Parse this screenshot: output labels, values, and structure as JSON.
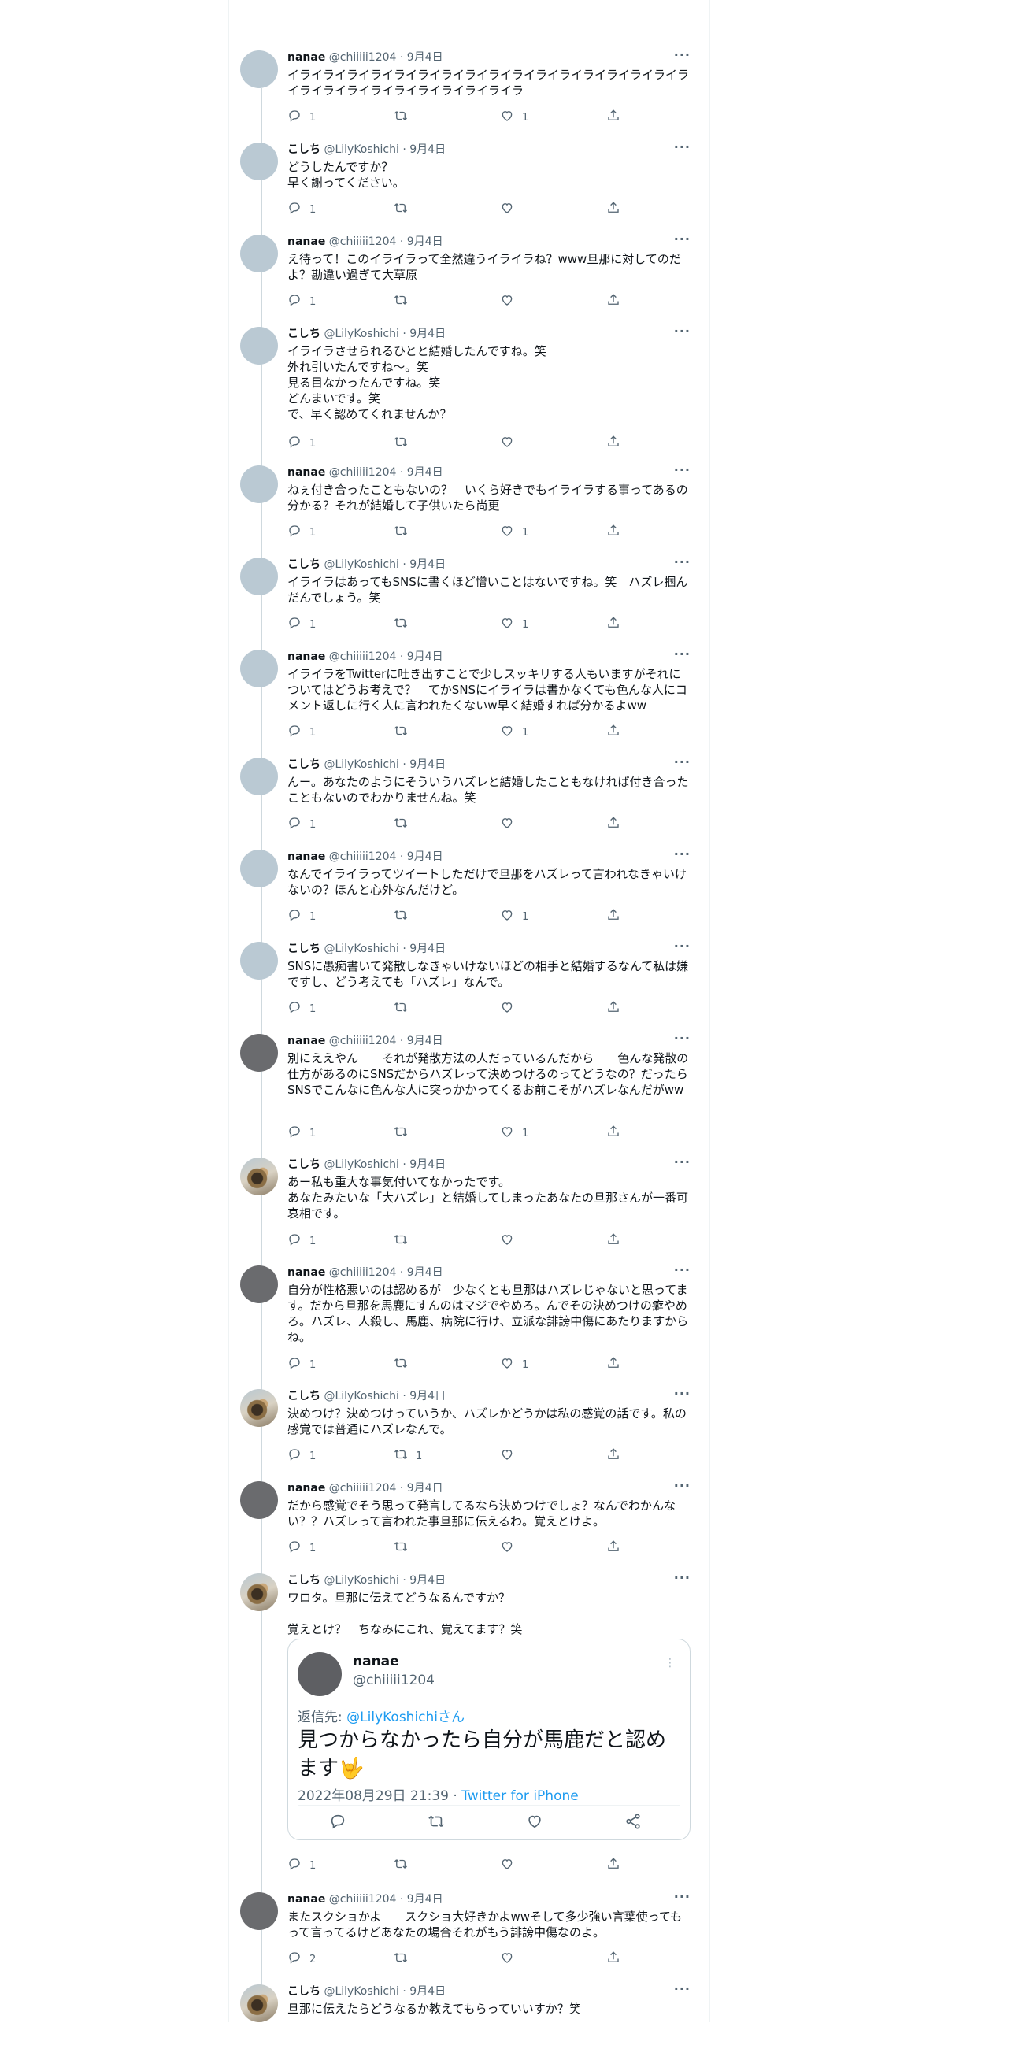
{
  "colors": {
    "accent": "#1d9bf0",
    "muted": "#536471",
    "thread": "#cfd9de"
  },
  "tweets": [
    {
      "name": "nanae",
      "handle": "@chiiiii1204",
      "date": "9月4日",
      "avatar": "light",
      "text": "イライライライライライライライライライライライライライライライライライライライライライライライライライライラ",
      "reply": "1",
      "retweet": "",
      "like": "1"
    },
    {
      "name": "こしち",
      "handle": "@LilyKoshichi",
      "date": "9月4日",
      "avatar": "light",
      "text": "どうしたんですか？\n早く謝ってください。",
      "reply": "1",
      "retweet": "",
      "like": ""
    },
    {
      "name": "nanae",
      "handle": "@chiiiii1204",
      "date": "9月4日",
      "avatar": "light",
      "text": "え待って！このイライラって全然違うイライラね？www旦那に対してのだよ？勘違い過ぎて大草原",
      "reply": "1",
      "retweet": "",
      "like": ""
    },
    {
      "name": "こしち",
      "handle": "@LilyKoshichi",
      "date": "9月4日",
      "avatar": "light",
      "text": "イライラさせられるひとと結婚したんですね。笑\n外れ引いたんですね〜。笑\n見る目なかったんですね。笑\nどんまいです。笑\nで、早く認めてくれませんか？",
      "reply": "1",
      "retweet": "",
      "like": ""
    },
    {
      "name": "nanae",
      "handle": "@chiiiii1204",
      "date": "9月4日",
      "avatar": "light",
      "text": "ねぇ付き合ったこともないの？　いくら好きでもイライラする事ってあるの分かる？それが結婚して子供いたら尚更",
      "reply": "1",
      "retweet": "",
      "like": "1"
    },
    {
      "name": "こしち",
      "handle": "@LilyKoshichi",
      "date": "9月4日",
      "avatar": "light",
      "text": "イライラはあってもSNSに書くほど憎いことはないですね。笑　ハズレ掴んだんでしょう。笑",
      "reply": "1",
      "retweet": "",
      "like": "1"
    },
    {
      "name": "nanae",
      "handle": "@chiiiii1204",
      "date": "9月4日",
      "avatar": "light",
      "text": "イライラをTwitterに吐き出すことで少しスッキリする人もいますがそれについてはどうお考えで？　てかSNSにイライラは書かなくても色んな人にコメント返しに行く人に言われたくないw早く結婚すれば分かるよww",
      "reply": "1",
      "retweet": "",
      "like": "1"
    },
    {
      "name": "こしち",
      "handle": "@LilyKoshichi",
      "date": "9月4日",
      "avatar": "light",
      "text": "んー。あなたのようにそういうハズレと結婚したこともなければ付き合ったこともないのでわかりませんね。笑",
      "reply": "1",
      "retweet": "",
      "like": ""
    },
    {
      "name": "nanae",
      "handle": "@chiiiii1204",
      "date": "9月4日",
      "avatar": "light",
      "text": "なんでイライラってツイートしただけで旦那をハズレって言われなきゃいけないの？ほんと心外なんだけど。",
      "reply": "1",
      "retweet": "",
      "like": "1"
    },
    {
      "name": "こしち",
      "handle": "@LilyKoshichi",
      "date": "9月4日",
      "avatar": "light",
      "text": "SNSに愚痴書いて発散しなきゃいけないほどの相手と結婚するなんて私は嫌ですし、どう考えても「ハズレ」なんで。",
      "reply": "1",
      "retweet": "",
      "like": ""
    },
    {
      "name": "nanae",
      "handle": "@chiiiii1204",
      "date": "9月4日",
      "avatar": "dark",
      "text": "別にええやん　　それが発散方法の人だっているんだから　　色んな発散の仕方があるのにSNSだからハズレって決めつけるのってどうなの？だったらSNSでこんなに色んな人に突っかかってくるお前こそがハズレなんだがww",
      "reply": "1",
      "retweet": "",
      "like": "1"
    },
    {
      "name": "こしち",
      "handle": "@LilyKoshichi",
      "date": "9月4日",
      "avatar": "photo",
      "text": "あー私も重大な事気付いてなかったです。\nあなたみたいな「大ハズレ」と結婚してしまったあなたの旦那さんが一番可哀相です。",
      "reply": "1",
      "retweet": "",
      "like": ""
    },
    {
      "name": "nanae",
      "handle": "@chiiiii1204",
      "date": "9月4日",
      "avatar": "dark",
      "text": "自分が性格悪いのは認めるが　少なくとも旦那はハズレじゃないと思ってます。だから旦那を馬鹿にすんのはマジでやめろ。んでその決めつけの癖やめろ。ハズレ、人殺し、馬鹿、病院に行け、立派な誹謗中傷にあたりますからね。",
      "reply": "1",
      "retweet": "",
      "like": "1"
    },
    {
      "name": "こしち",
      "handle": "@LilyKoshichi",
      "date": "9月4日",
      "avatar": "photo",
      "text": "決めつけ？決めつけっていうか、ハズレかどうかは私の感覚の話です。私の感覚では普通にハズレなんで。",
      "reply": "1",
      "retweet": "1",
      "like": ""
    },
    {
      "name": "nanae",
      "handle": "@chiiiii1204",
      "date": "9月4日",
      "avatar": "dark",
      "text": "だから感覚でそう思って発言してるなら決めつけでしょ？なんでわかんない？？ハズレって言われた事旦那に伝えるわ。覚えとけよ。",
      "reply": "1",
      "retweet": "",
      "like": ""
    },
    {
      "name": "こしち",
      "handle": "@LilyKoshichi",
      "date": "9月4日",
      "avatar": "photo",
      "text": "ワロタ。旦那に伝えてどうなるんですか？\n\n覚えとけ？　ちなみにこれ、覚えてます？笑",
      "reply": "1",
      "retweet": "",
      "like": ""
    },
    {
      "name": "nanae",
      "handle": "@chiiiii1204",
      "date": "9月4日",
      "avatar": "dark",
      "text": "またスクショかよ　　スクショ大好きかよwwそして多少強い言葉使ってもって言ってるけどあなたの場合それがもう誹謗中傷なのよ。",
      "reply": "2",
      "retweet": "",
      "like": ""
    },
    {
      "name": "こしち",
      "handle": "@LilyKoshichi",
      "date": "9月4日",
      "avatar": "photo",
      "text": "旦那に伝えたらどうなるか教えてもらっていいすか？笑",
      "reply": "",
      "retweet": "",
      "like": ""
    }
  ],
  "quote": {
    "name": "nanae",
    "handle": "@chiiiii1204",
    "reply_prefix": "返信先: ",
    "reply_to": "@LilyKoshichiさん",
    "body": "見つからなかったら自分が馬鹿だと認めます🤟",
    "time": "2022年08月29日 21:39",
    "separator": " · ",
    "source": "Twitter for iPhone"
  },
  "icons": [
    "reply-icon",
    "retweet-icon",
    "like-icon",
    "share-icon",
    "more-icon"
  ]
}
